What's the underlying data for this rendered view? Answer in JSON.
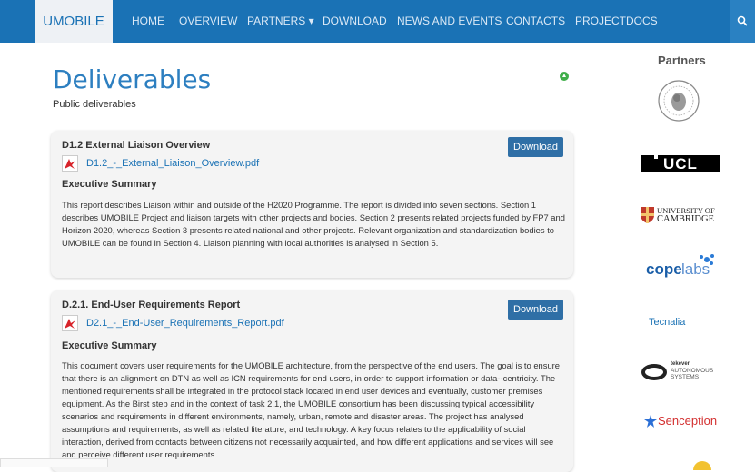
{
  "nav": {
    "brand": "UMOBILE",
    "items": [
      "HOME",
      "OVERVIEW",
      "PARTNERS ▾",
      "DOWNLOAD",
      "NEWS AND EVENTS",
      "CONTACTS",
      "PROJECTDOCS"
    ]
  },
  "page": {
    "title": "Deliverables",
    "subtitle": "Public deliverables"
  },
  "deliverables": [
    {
      "title": "D1.2 External Liaison Overview",
      "file": "D1.2_-_External_Liaison_Overview.pdf",
      "download_label": "Download",
      "section_title": "Executive Summary",
      "summary": "This report describes Liaison within and outside of the H2020 Programme. The report is divided into seven sections. Section 1 describes UMOBILE Project and liaison targets with other projects and bodies. Section 2 presents related projects funded by FP7 and Horizon 2020, whereas Section 3 presents related national and other projects. Relevant organization and standardization bodies to UMOBILE can be found in Section 4. Liaison planning with local authorities is analysed in Section 5."
    },
    {
      "title": "D.2.1. End-User Requirements Report",
      "file": "D2.1_-_End-User_Requirements_Report.pdf",
      "download_label": "Download",
      "section_title": "Executive Summary",
      "summary": "This document covers user requirements for the UMOBILE architecture, from the perspective of the end users. The goal is to ensure that there is an alignment on DTN as well as ICN requirements for end users, in order to support information or data--centricity. The mentioned requirements shall be integrated in the protocol stack located in end user devices and eventually, customer premises equipment. As the Birst step and in the context of task 2.1, the UMOBILE consortium has been discussing typical accessibility scenarios and requirements in different environments, namely, urban, remote and disaster areas. The project has analysed assumptions and requirements, as well as related literature, and technology. A key focus relates to the applicability of social interaction, derived from contacts between citizens not necessarily acquainted, and how different applications and services will see and perceive different user requirements."
    }
  ],
  "sidebar": {
    "title": "Partners",
    "logos": {
      "ucl": "UCL",
      "cambridge_line1": "UNIVERSITY OF",
      "cambridge_line2": "CAMBRIDGE",
      "cope_a": "cope",
      "cope_b": "labs",
      "tecnalia": "Tecnalia",
      "tekever_a": "tekever",
      "tekever_b": "AUTONOMOUS",
      "tekever_c": "SYSTEMS",
      "senception": "Senception"
    }
  },
  "colors": {
    "navbar": "#1a72b5",
    "title": "#2d7fc0",
    "button": "#2f6fa6",
    "status": "#3fae49"
  }
}
